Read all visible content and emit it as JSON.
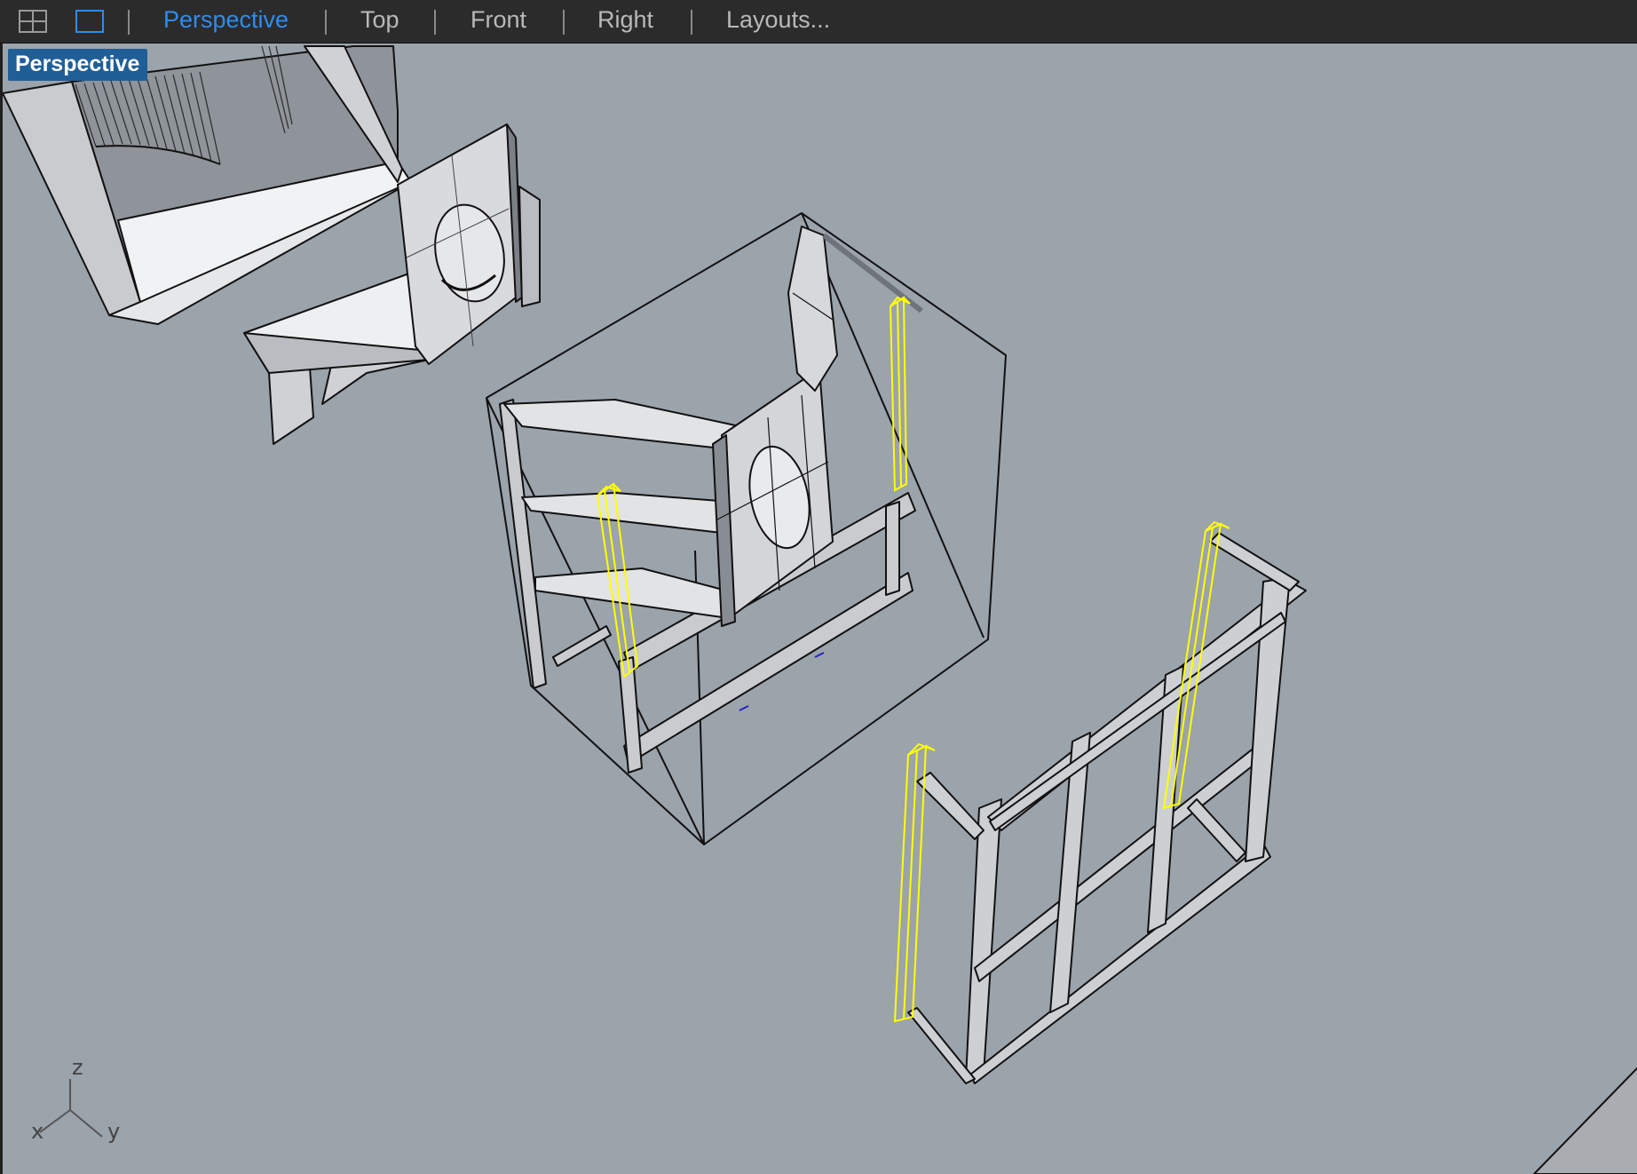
{
  "toolbar": {
    "layout_icons": [
      {
        "name": "four-viewports-icon"
      },
      {
        "name": "single-viewport-icon"
      }
    ],
    "tabs": [
      {
        "label": "Perspective",
        "active": true
      },
      {
        "label": "Top",
        "active": false
      },
      {
        "label": "Front",
        "active": false
      },
      {
        "label": "Right",
        "active": false
      },
      {
        "label": "Layouts...",
        "active": false
      }
    ]
  },
  "viewport": {
    "label": "Perspective",
    "axes": {
      "x": "x",
      "y": "y",
      "z": "z"
    }
  },
  "colors": {
    "toolbar_bg": "#2b2b2b",
    "tab_active": "#2f8cf0",
    "tab_inactive": "#b9b9b9",
    "viewport_bg": "#9ba3ab",
    "label_bg": "#1f5e97",
    "selection": "#ffff00",
    "model_face": "#dcdde0",
    "model_edge": "#111111"
  }
}
